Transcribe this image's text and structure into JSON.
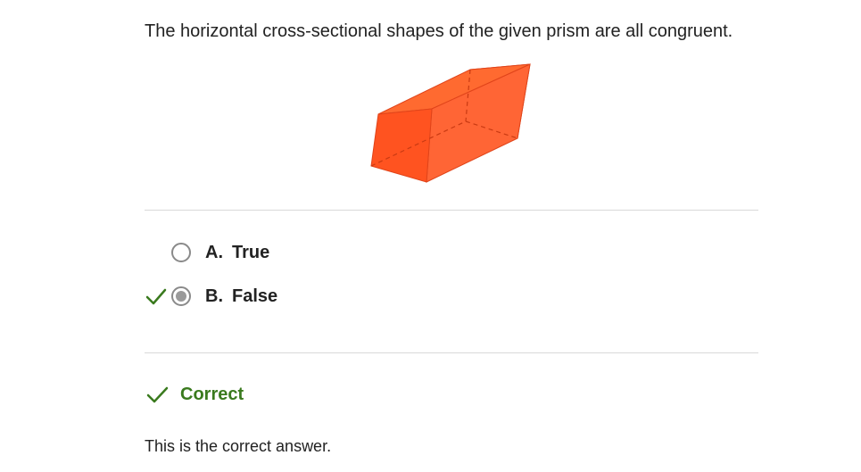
{
  "question": {
    "text": "The horizontal cross-sectional shapes of the given prism are all congruent."
  },
  "figure": {
    "icon": "prism-figure",
    "color": "#ff5a20"
  },
  "options": [
    {
      "letter": "A.",
      "text": "True",
      "selected": false,
      "marked_correct": false
    },
    {
      "letter": "B.",
      "text": "False",
      "selected": true,
      "marked_correct": true
    }
  ],
  "result": {
    "label": "Correct",
    "color": "#3a7a1e"
  },
  "explanation": "This is the correct answer."
}
